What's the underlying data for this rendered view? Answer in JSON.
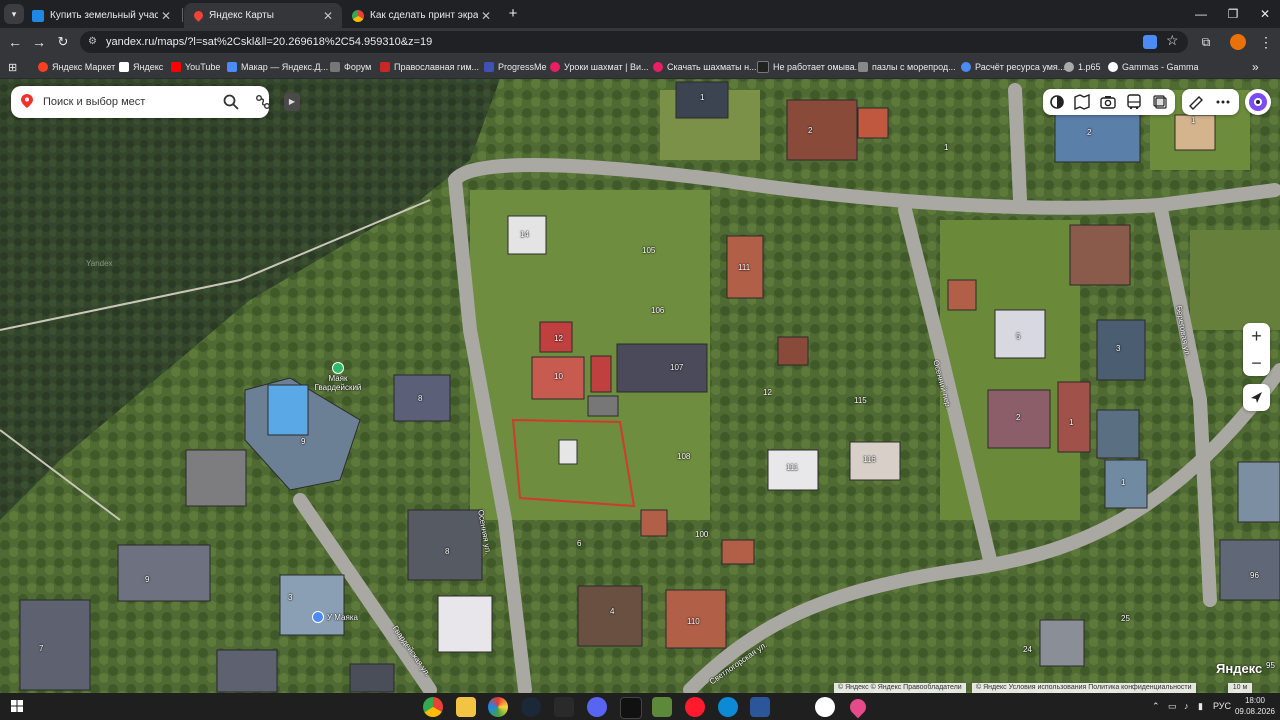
{
  "browser": {
    "tabs": [
      {
        "title": "Купить земельный участок в К",
        "active": false
      },
      {
        "title": "Яндекс Карты",
        "active": true
      },
      {
        "title": "Как сделать принт экрана на н",
        "active": false
      }
    ],
    "new_tab_label": "+",
    "url": "yandex.ru/maps/?l=sat%2Cskl&ll=20.269618%2C54.959310&z=19",
    "bookmarks": [
      {
        "label": "Яндекс Маркет",
        "color": "#fc3f1d"
      },
      {
        "label": "Яндекс",
        "color": "#ffffff"
      },
      {
        "label": "YouTube",
        "color": "#ff0000"
      },
      {
        "label": "Макар — Яндекс.Д...",
        "color": "#4c8bf5"
      },
      {
        "label": "Форум",
        "color": "#777777"
      },
      {
        "label": "Православная гим...",
        "color": "#c62828"
      },
      {
        "label": "ProgressMe",
        "color": "#3f51b5"
      },
      {
        "label": "Уроки шахмат | Ви...",
        "color": "#e91e63"
      },
      {
        "label": "Скачать шахматы н...",
        "color": "#e91e63"
      },
      {
        "label": "Не работает омыва...",
        "color": "#222222"
      },
      {
        "label": "пазлы с морепрод...",
        "color": "#888888"
      },
      {
        "label": "Расчёт ресурса умя...",
        "color": "#4c8bf5"
      },
      {
        "label": "1.p65",
        "color": "#aaaaaa"
      },
      {
        "label": "Gammas - Gamma",
        "color": "#ffffff"
      }
    ],
    "more_bookmarks": "»"
  },
  "map": {
    "search_placeholder": "Поиск и выбор мест",
    "zoom_in": "+",
    "zoom_out": "−",
    "brand": "Яндекс",
    "copyright_left": "© Яндекс © Яндекс  Правообладатели",
    "copyright_right": "© Яндекс  Условия использования  Политика конфиденциальности",
    "scale": "10 м",
    "watermark": "Yandex",
    "poi": [
      {
        "label": "Маяк Гвардейский"
      },
      {
        "label": "У Маяка"
      }
    ],
    "street_labels": [
      "Осенняя ул.",
      "Гвардейская ул.",
      "Светлогорская ул.",
      "Береговая ул.",
      "Осенний пер."
    ],
    "house_numbers": [
      "1",
      "2",
      "2",
      "1",
      "1",
      "2",
      "14",
      "105",
      "111",
      "106",
      "12",
      "107",
      "10",
      "8",
      "12",
      "115",
      "9",
      "108",
      "111",
      "116",
      "5",
      "3",
      "2",
      "1",
      "1",
      "6",
      "100",
      "4",
      "110",
      "9",
      "8",
      "3",
      "7",
      "7",
      "25",
      "24",
      "96",
      "95",
      "116",
      "1к1",
      "5"
    ],
    "accent": "#d03a2f"
  },
  "taskbar": {
    "lang": "РУС",
    "time": "18:00",
    "date": "09.08.2026"
  }
}
